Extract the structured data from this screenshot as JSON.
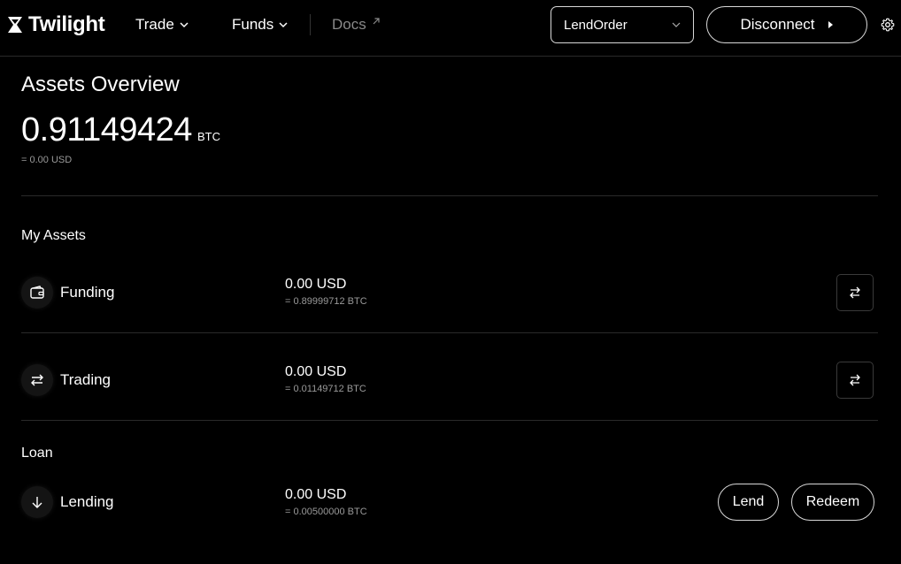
{
  "header": {
    "brand": "Twilight",
    "nav": [
      {
        "label": "Trade"
      },
      {
        "label": "Funds"
      },
      {
        "label": "Docs"
      }
    ],
    "account_select": {
      "value": "LendOrder"
    },
    "disconnect_label": "Disconnect",
    "icons": [
      "twilight-logo-icon",
      "chevron-down-icon",
      "external-link-icon",
      "caret-right-icon",
      "gear-icon"
    ]
  },
  "overview": {
    "title": "Assets Overview",
    "total_btc": "0.91149424",
    "unit": "BTC",
    "total_usd": "= 0.00 USD"
  },
  "my_assets": {
    "label": "My Assets",
    "rows": [
      {
        "name": "Funding",
        "usd": "0.00 USD",
        "btc": "= 0.89999712 BTC",
        "icon": "wallet-icon"
      },
      {
        "name": "Trading",
        "usd": "0.00 USD",
        "btc": "= 0.01149712 BTC",
        "icon": "transfer-icon"
      }
    ]
  },
  "loan": {
    "label": "Loan",
    "rows": [
      {
        "name": "Lending",
        "usd": "0.00 USD",
        "btc": "= 0.00500000 BTC",
        "icon": "arrow-down-icon"
      }
    ],
    "lend_label": "Lend",
    "redeem_label": "Redeem"
  }
}
